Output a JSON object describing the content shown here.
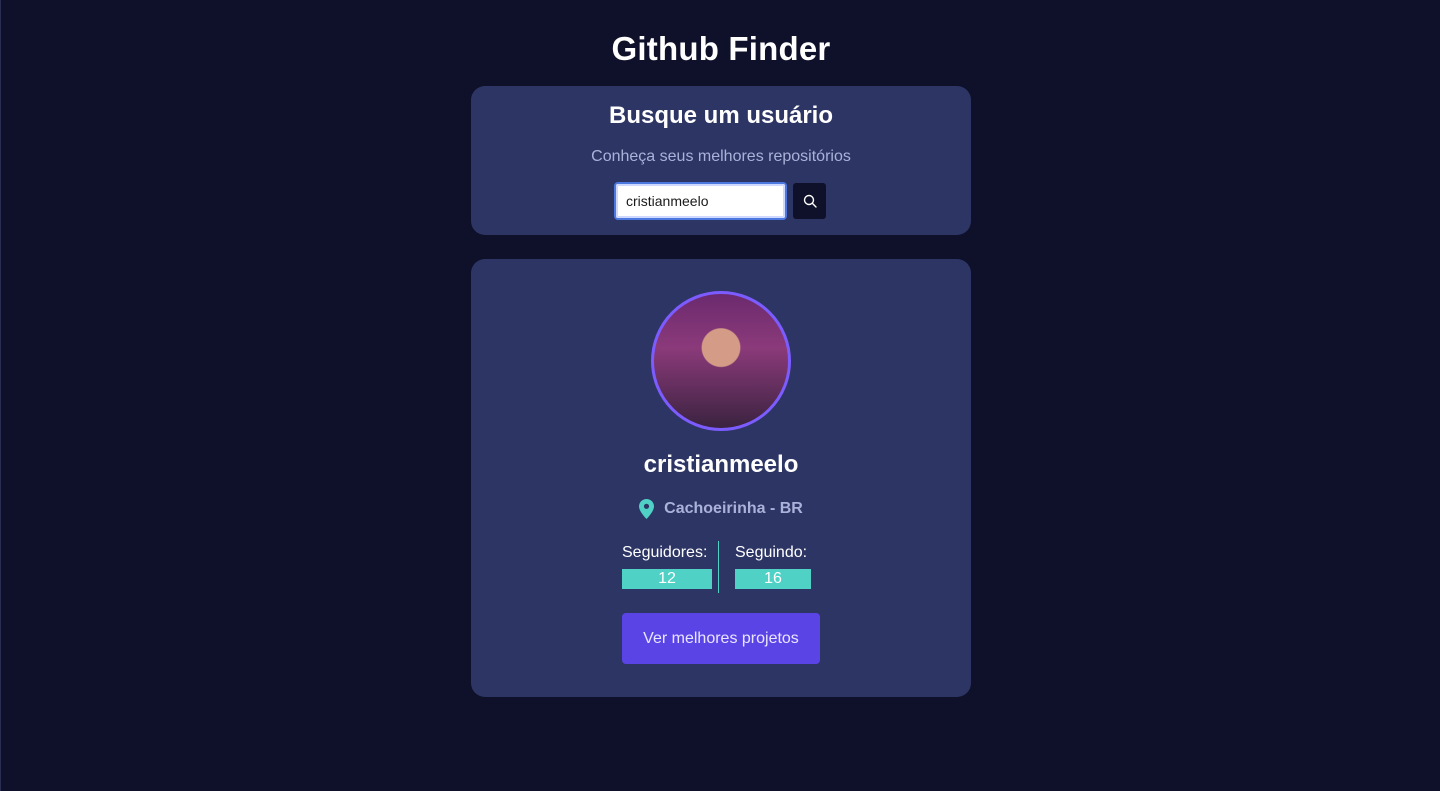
{
  "app": {
    "title": "Github Finder"
  },
  "search": {
    "title": "Busque um usuário",
    "subtitle": "Conheça seus melhores repositórios",
    "input_value": "cristianmeelo",
    "button_icon": "search-icon"
  },
  "profile": {
    "username": "cristianmeelo",
    "location": "Cachoeirinha - BR",
    "location_icon": "map-pin-icon",
    "followers_label": "Seguidores:",
    "followers_value": "12",
    "following_label": "Seguindo:",
    "following_value": "16",
    "projects_button": "Ver melhores projetos"
  },
  "colors": {
    "background": "#0e1129",
    "card": "#2d3565",
    "accent": "#5b44e6",
    "teal": "#4fd1c5",
    "avatar_border": "#7c5cff"
  }
}
